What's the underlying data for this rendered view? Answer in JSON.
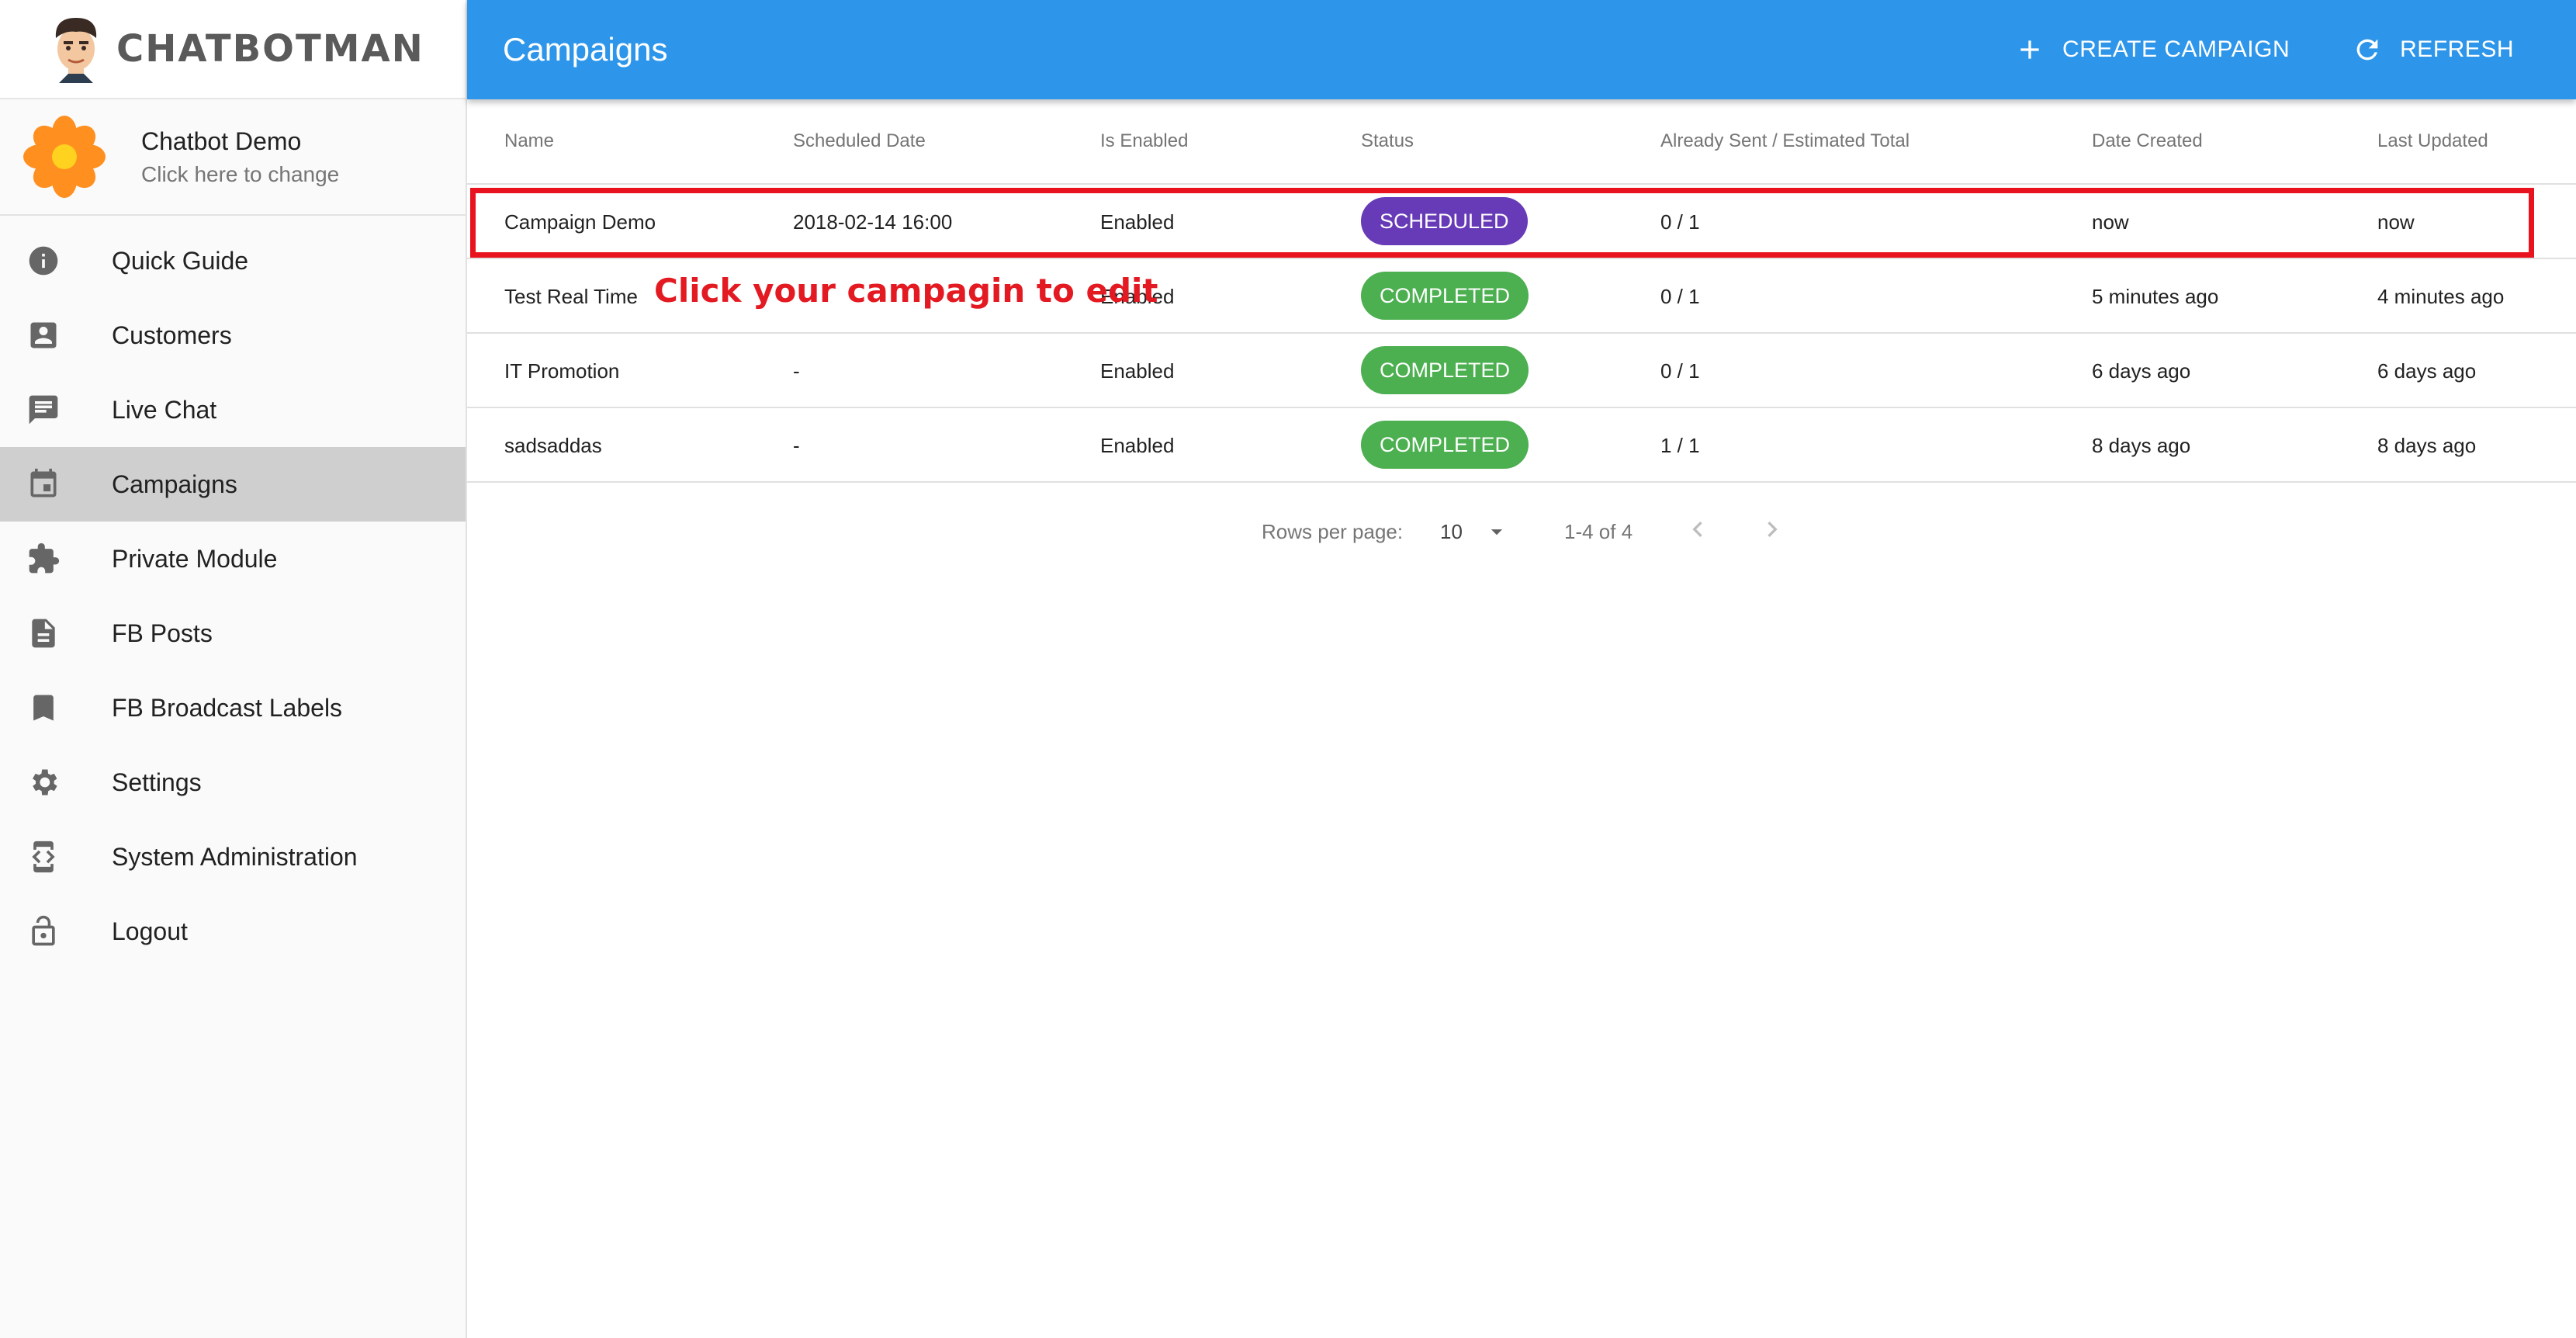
{
  "brand": {
    "name": "CHATBOTMAN"
  },
  "bot": {
    "name": "Chatbot Demo",
    "hint": "Click here to change"
  },
  "sidebar": {
    "items": [
      {
        "label": "Quick Guide",
        "icon": "info-icon"
      },
      {
        "label": "Customers",
        "icon": "contact-icon"
      },
      {
        "label": "Live Chat",
        "icon": "chat-icon"
      },
      {
        "label": "Campaigns",
        "icon": "calendar-icon",
        "active": true
      },
      {
        "label": "Private Module",
        "icon": "puzzle-icon"
      },
      {
        "label": "FB Posts",
        "icon": "document-icon"
      },
      {
        "label": "FB Broadcast Labels",
        "icon": "bookmark-icon"
      },
      {
        "label": "Settings",
        "icon": "gear-icon"
      },
      {
        "label": "System Administration",
        "icon": "developer-icon"
      },
      {
        "label": "Logout",
        "icon": "lock-icon"
      }
    ]
  },
  "header": {
    "title": "Campaigns",
    "create_label": "CREATE CAMPAIGN",
    "refresh_label": "REFRESH",
    "color": "#2e96ea"
  },
  "table": {
    "columns": [
      "Name",
      "Scheduled Date",
      "Is Enabled",
      "Status",
      "Already Sent / Estimated Total",
      "Date Created",
      "Last Updated"
    ],
    "rows": [
      {
        "name": "Campaign Demo",
        "scheduled": "2018-02-14 16:00",
        "enabled": "Enabled",
        "status": "SCHEDULED",
        "sent": "0 / 1",
        "created": "now",
        "updated": "now"
      },
      {
        "name": "Test Real Time",
        "scheduled": "",
        "enabled": "Enabled",
        "status": "COMPLETED",
        "sent": "0 / 1",
        "created": "5 minutes ago",
        "updated": "4 minutes ago"
      },
      {
        "name": "IT Promotion",
        "scheduled": "-",
        "enabled": "Enabled",
        "status": "COMPLETED",
        "sent": "0 / 1",
        "created": "6 days ago",
        "updated": "6 days ago"
      },
      {
        "name": "sadsaddas",
        "scheduled": "-",
        "enabled": "Enabled",
        "status": "COMPLETED",
        "sent": "1 / 1",
        "created": "8 days ago",
        "updated": "8 days ago"
      }
    ],
    "status_colors": {
      "SCHEDULED": "#673ab7",
      "COMPLETED": "#4caf50"
    }
  },
  "annotation": {
    "text": "Click your campagin to edit",
    "color": "#e8131f"
  },
  "pagination": {
    "rows_label": "Rows per page:",
    "rows_value": "10",
    "range": "1-4 of 4"
  }
}
